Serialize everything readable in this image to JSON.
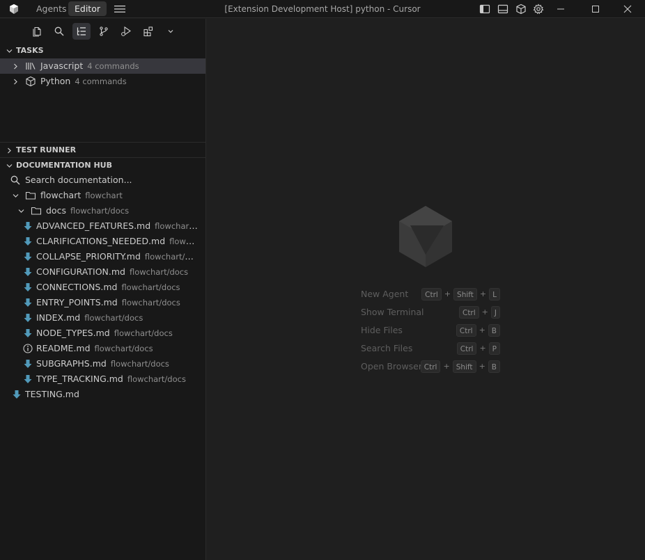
{
  "titlebar": {
    "tabs": [
      "Agents",
      "Editor"
    ],
    "active_tab": "Editor",
    "window_title": "[Extension Development Host] python - Cursor"
  },
  "sidebar": {
    "sections": {
      "tasks": "TASKS",
      "test_runner": "TEST RUNNER",
      "docs_hub": "DOCUMENTATION HUB"
    },
    "tasks": [
      {
        "name": "Javascript",
        "desc": "4 commands",
        "icon": "library-icon"
      },
      {
        "name": "Python",
        "desc": "4 commands",
        "icon": "package-icon"
      }
    ],
    "docs": {
      "search_placeholder": "Search documentation...",
      "root_folder": {
        "name": "flowchart",
        "desc": "flowchart"
      },
      "sub_folder": {
        "name": "docs",
        "desc": "flowchart/docs"
      },
      "files": [
        {
          "name": "ADVANCED_FEATURES.md",
          "desc": "flowchart/d..."
        },
        {
          "name": "CLARIFICATIONS_NEEDED.md",
          "desc": "flowchar..."
        },
        {
          "name": "COLLAPSE_PRIORITY.md",
          "desc": "flowchart/docs"
        },
        {
          "name": "CONFIGURATION.md",
          "desc": "flowchart/docs"
        },
        {
          "name": "CONNECTIONS.md",
          "desc": "flowchart/docs"
        },
        {
          "name": "ENTRY_POINTS.md",
          "desc": "flowchart/docs"
        },
        {
          "name": "INDEX.md",
          "desc": "flowchart/docs"
        },
        {
          "name": "NODE_TYPES.md",
          "desc": "flowchart/docs"
        },
        {
          "name": "README.md",
          "desc": "flowchart/docs"
        },
        {
          "name": "SUBGRAPHS.md",
          "desc": "flowchart/docs"
        },
        {
          "name": "TYPE_TRACKING.md",
          "desc": "flowchart/docs"
        }
      ],
      "root_file": "TESTING.md"
    }
  },
  "editor": {
    "shortcuts": [
      {
        "label": "New Agent",
        "keys": [
          "Ctrl",
          "Shift",
          "L"
        ]
      },
      {
        "label": "Show Terminal",
        "keys": [
          "Ctrl",
          "J"
        ]
      },
      {
        "label": "Hide Files",
        "keys": [
          "Ctrl",
          "B"
        ]
      },
      {
        "label": "Search Files",
        "keys": [
          "Ctrl",
          "P"
        ]
      },
      {
        "label": "Open Browser",
        "keys": [
          "Ctrl",
          "Shift",
          "B"
        ]
      }
    ],
    "plus_sign": "+"
  },
  "colors": {
    "markdown_icon": "#519aba",
    "info_icon": "#cccccc",
    "selected_row": "#37373d"
  }
}
